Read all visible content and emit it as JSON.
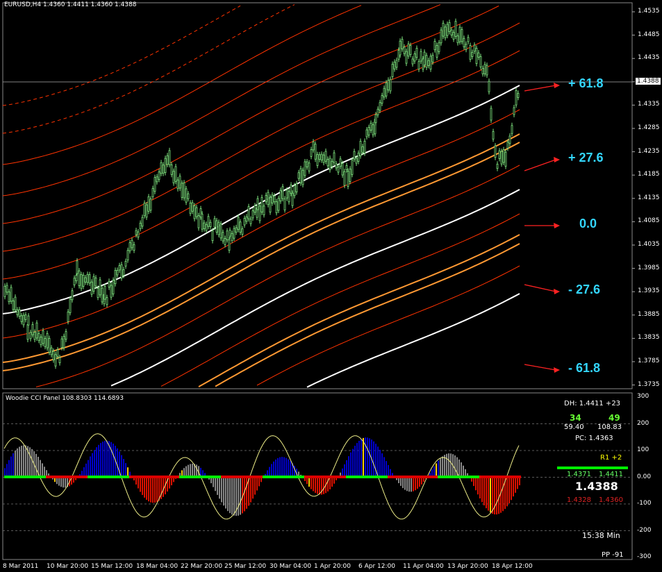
{
  "window": {
    "title": "EURUSD,H4  1.4360 1.4411 1.4360 1.4388",
    "current_price_tag": "1.4388"
  },
  "price_axis": {
    "ticks": [
      "1.4535",
      "1.4485",
      "1.4435",
      "1.4385",
      "1.4335",
      "1.4285",
      "1.4235",
      "1.4185",
      "1.4135",
      "1.4085",
      "1.4035",
      "1.3985",
      "1.3935",
      "1.3885",
      "1.3835",
      "1.3785",
      "1.3735"
    ]
  },
  "levels": [
    "+ 61.8",
    "+ 27.6",
    "0.0",
    "- 27.6",
    "- 61.8"
  ],
  "indicator": {
    "title": "Woodie CCI Panel 108.8303 114.6893",
    "axis_ticks": [
      "300",
      "200",
      "100",
      "0.00",
      "-100",
      "-200",
      "-300"
    ],
    "dh": "DH: 1.4411 +23",
    "num_left": "34",
    "num_right": "49",
    "val_left": "59.40",
    "val_right": "108.83",
    "pc": "PC: 1.4363",
    "r1": "R1 +2",
    "range_left": "1.4371",
    "range_right": "1.4411",
    "price": "1.4388",
    "low_left": "1.4328",
    "low_right": "1.4360",
    "time": "15:38 Min",
    "pp": "PP -91"
  },
  "time_axis": {
    "labels": [
      "8 Mar 2011",
      "10 Mar 20:00",
      "15 Mar 12:00",
      "18 Mar 04:00",
      "22 Mar 20:00",
      "25 Mar 12:00",
      "30 Mar 04:00",
      "1 Apr 20:00",
      "6 Apr 12:00",
      "11 Apr 04:00",
      "13 Apr 20:00",
      "18 Apr 12:00"
    ]
  },
  "colors": {
    "candles": "#7fe57f",
    "white_band": "#ffffff",
    "orange_band": "#ff9933",
    "red_band": "#ff3300",
    "level_text": "#33d6ff",
    "arrow": "#ff2222",
    "cci_blue": "#0000cc",
    "cci_red": "#dd1100",
    "cci_gray": "#888888",
    "cci_yellow": "#ffcc00",
    "zero_green": "#00ee00",
    "zero_red": "#dd0000"
  }
}
